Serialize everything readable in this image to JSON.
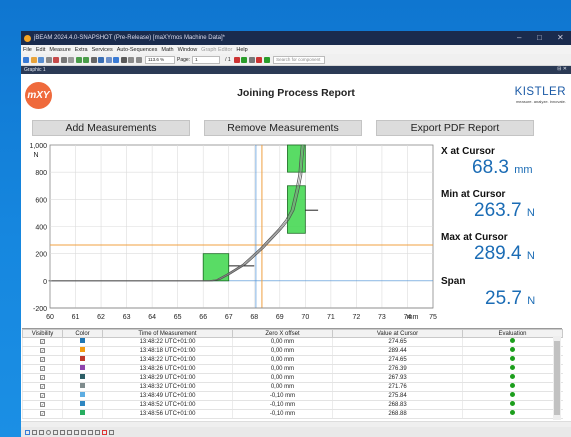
{
  "window": {
    "title": "jBEAM 2024.4.0-SNAPSHOT (Pre-Release) [maXYmos Machine Data]*"
  },
  "menu": [
    {
      "label": "File",
      "enabled": true
    },
    {
      "label": "Edit",
      "enabled": true
    },
    {
      "label": "Measure",
      "enabled": true
    },
    {
      "label": "Extra",
      "enabled": true
    },
    {
      "label": "Services",
      "enabled": true
    },
    {
      "label": "Auto-Sequences",
      "enabled": true
    },
    {
      "label": "Math",
      "enabled": true
    },
    {
      "label": "Window",
      "enabled": true
    },
    {
      "label": "Graph Editor",
      "enabled": false
    },
    {
      "label": "Help",
      "enabled": true
    }
  ],
  "toolbar": {
    "zoom": "113.6 %",
    "page_label": "Page:",
    "page_value": "1",
    "page_total": "/ 1",
    "search_placeholder": "Search for component"
  },
  "graph_tab": {
    "label": "Graphic 1"
  },
  "report": {
    "logo_text": "mXY",
    "title": "Joining Process Report",
    "brand": "KISTLER",
    "tagline": "measure. analyze. innovate."
  },
  "buttons": {
    "add": "Add Measurements",
    "remove": "Remove Measurements",
    "export": "Export PDF Report"
  },
  "chart_data": {
    "type": "line",
    "xlim": [
      60,
      75
    ],
    "ylim": [
      -200,
      1000
    ],
    "x_ticks": [
      "60",
      "61",
      "62",
      "63",
      "64",
      "65",
      "66",
      "67",
      "68",
      "69",
      "70",
      "71",
      "72",
      "73",
      "74",
      "75"
    ],
    "y_ticks": [
      "-200",
      "0",
      "200",
      "400",
      "600",
      "800",
      "1,000"
    ],
    "x_unit": "mm",
    "y_unit": "N",
    "grid": true,
    "cursor_x": 68.3,
    "cursor_y": 263.7,
    "cursor_color": "#f0a040",
    "crosshair_color": "#4a8fd6",
    "curve_color": "#555555",
    "window_color": "#3cd64a",
    "curve": [
      [
        60,
        0
      ],
      [
        66.3,
        0
      ],
      [
        66.6,
        10
      ],
      [
        67,
        50
      ],
      [
        67.6,
        120
      ],
      [
        68.3,
        240
      ],
      [
        69,
        380
      ],
      [
        69.3,
        450
      ],
      [
        69.5,
        520
      ],
      [
        69.6,
        600
      ],
      [
        69.7,
        680
      ],
      [
        69.8,
        780
      ],
      [
        69.85,
        900
      ],
      [
        69.9,
        1000
      ]
    ],
    "eval_windows": [
      {
        "x": [
          66,
          67
        ],
        "y": [
          0,
          200
        ]
      },
      {
        "x": [
          69.3,
          70
        ],
        "y": [
          350,
          700
        ]
      },
      {
        "x": [
          69.3,
          70
        ],
        "y": [
          800,
          1000
        ]
      }
    ],
    "threshold_lines": [
      {
        "x": [
          67,
          68
        ],
        "y": 110
      },
      {
        "x": [
          70,
          70.5
        ],
        "y": 520
      }
    ]
  },
  "stats": {
    "x_cursor": {
      "label": "X at Cursor",
      "value": "68.3",
      "unit": "mm"
    },
    "min_cursor": {
      "label": "Min at Cursor",
      "value": "263.7",
      "unit": "N"
    },
    "max_cursor": {
      "label": "Max at Cursor",
      "value": "289.4",
      "unit": "N"
    },
    "span": {
      "label": "Span",
      "value": "25.7",
      "unit": "N"
    }
  },
  "table": {
    "headers": [
      "Visibility",
      "Color",
      "Time of Measurement",
      "Zero X offset",
      "Value at Cursor",
      "Evaluation"
    ],
    "rows": [
      {
        "color": "#1f77b4",
        "time": "13:48:22 UTC+01:00",
        "offset": "0,00 mm",
        "value": "274.65"
      },
      {
        "color": "#f39c12",
        "time": "13:48:18 UTC+01:00",
        "offset": "0,00 mm",
        "value": "289.44"
      },
      {
        "color": "#c0392b",
        "time": "13:48:22 UTC+01:00",
        "offset": "0,00 mm",
        "value": "274.65"
      },
      {
        "color": "#8e44ad",
        "time": "13:48:26 UTC+01:00",
        "offset": "0,00 mm",
        "value": "276.39"
      },
      {
        "color": "#2c5e66",
        "time": "13:48:29 UTC+01:00",
        "offset": "0,00 mm",
        "value": "267.93"
      },
      {
        "color": "#7f8c8d",
        "time": "13:48:32 UTC+01:00",
        "offset": "0,00 mm",
        "value": "271.76"
      },
      {
        "color": "#5dade2",
        "time": "13:48:49 UTC+01:00",
        "offset": "-0,10 mm",
        "value": "275.84"
      },
      {
        "color": "#2e86c1",
        "time": "13:48:52 UTC+01:00",
        "offset": "-0,10 mm",
        "value": "268.83"
      },
      {
        "color": "#27ae60",
        "time": "13:48:56 UTC+01:00",
        "offset": "-0,10 mm",
        "value": "268.88"
      }
    ]
  }
}
